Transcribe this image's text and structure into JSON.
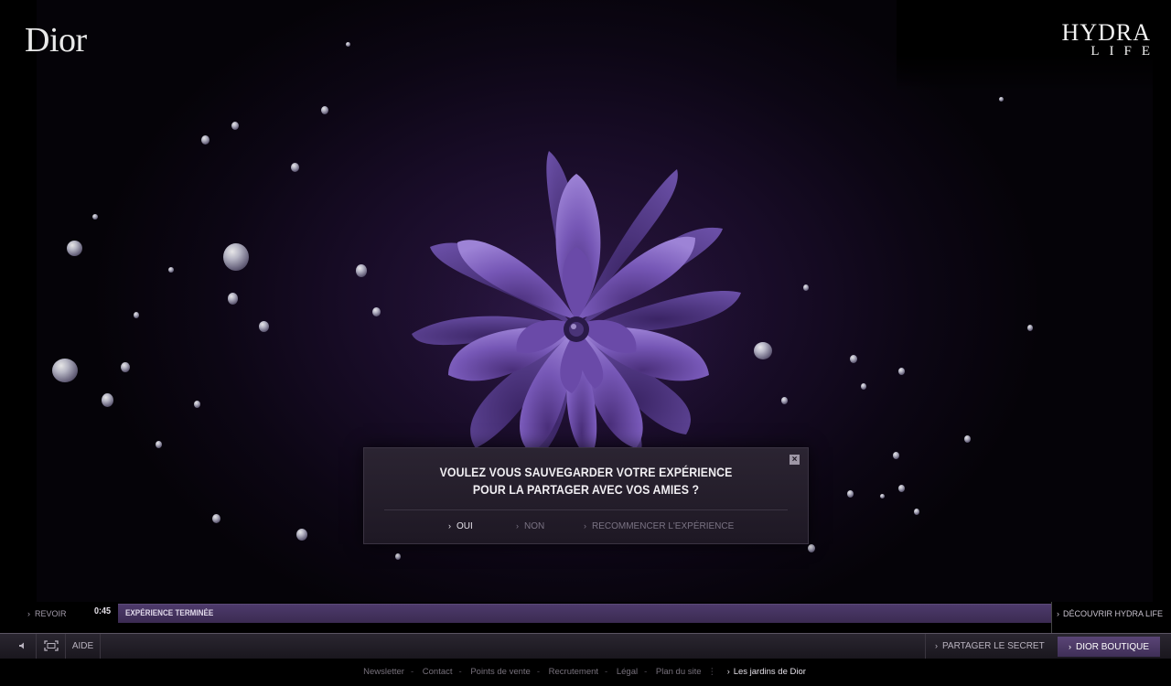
{
  "brand": {
    "logo": "Dior",
    "product_line1": "HYDRA",
    "product_line2": "LIFE"
  },
  "modal": {
    "question_line1": "VOULEZ VOUS SAUVEGARDER VOTRE EXPÉRIENCE",
    "question_line2": "POUR LA PARTAGER AVEC VOS AMIES ?",
    "close_label": "×",
    "actions": {
      "yes": "OUI",
      "no": "NON",
      "restart": "RECOMMENCER L'EXPÉRIENCE"
    }
  },
  "progress": {
    "revoir": "REVOIR",
    "time": "0:45",
    "status": "EXPÉRIENCE TERMINÉE",
    "fill": 1.0,
    "discover": "DÉCOUVRIR HYDRA LIFE"
  },
  "toolbar": {
    "sound_icon": "speaker-icon",
    "fullscreen_icon": "fullscreen-icon",
    "aide": "AIDE",
    "partager": "PARTAGER LE SECRET",
    "boutique": "DIOR BOUTIQUE"
  },
  "footer": {
    "links": [
      "Newsletter",
      "Contact",
      "Points de vente",
      "Recrutement",
      "Légal",
      "Plan du site"
    ],
    "highlight": "Les jardins de Dior"
  },
  "colors": {
    "accent": "#5a4576",
    "flower": "#7a5bb8",
    "background": "#1a0d2a"
  }
}
